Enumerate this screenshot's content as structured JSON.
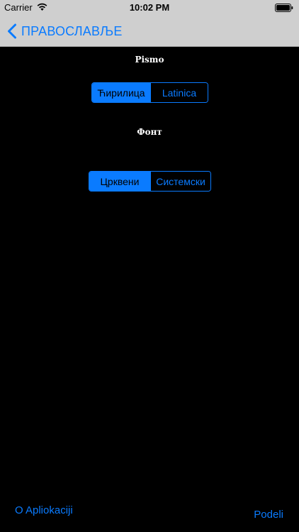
{
  "status_bar": {
    "carrier": "Carrier",
    "time": "10:02 PM"
  },
  "nav": {
    "back_label": "ПРАВОСЛАВЉЕ"
  },
  "script_section": {
    "label": "Pismo",
    "options": [
      "Ћирилица",
      "Latinica"
    ],
    "selected": "Ћирилица"
  },
  "font_section": {
    "label": "Фонт",
    "options": [
      "Црквени",
      "Системски"
    ],
    "selected": "Црквени"
  },
  "footer": {
    "about_label": "O Apliokaciji",
    "share_label": "Podeli"
  },
  "colors": {
    "accent": "#0a7bff",
    "background": "#000000",
    "bar": "#cfcfcf"
  },
  "icons": {
    "wifi": "wifi-icon",
    "battery": "battery-icon",
    "back": "chevron-left-icon"
  }
}
